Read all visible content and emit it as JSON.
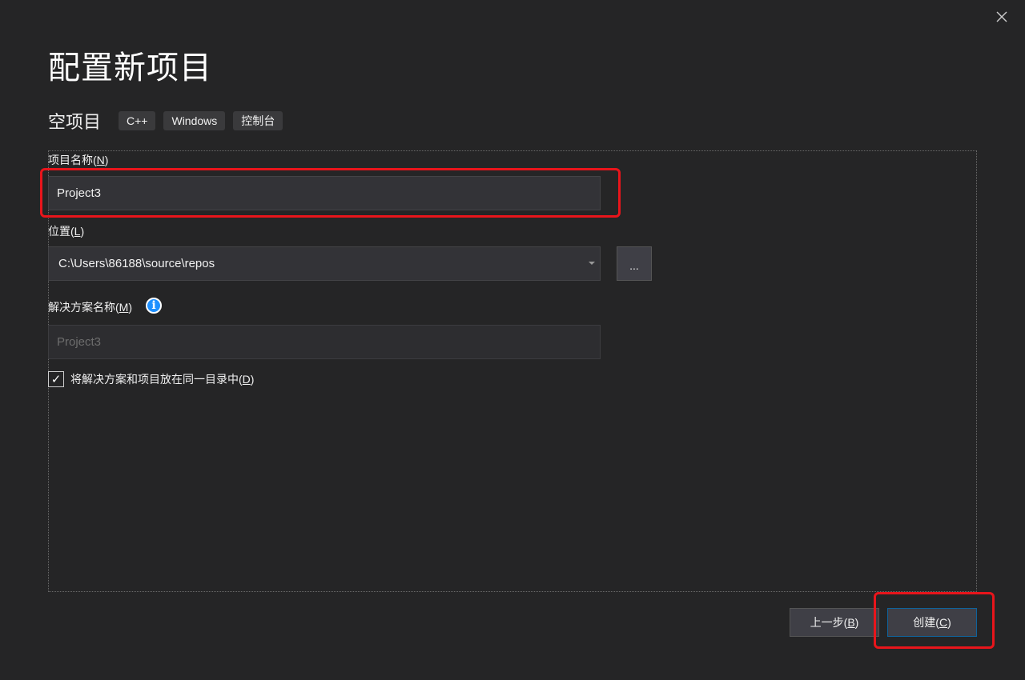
{
  "header": {
    "title": "配置新项目",
    "close_icon": "close-icon"
  },
  "template": {
    "name": "空项目",
    "tags": [
      "C++",
      "Windows",
      "控制台"
    ]
  },
  "form": {
    "project_name": {
      "label": "项目名称",
      "access_key": "N",
      "value": "Project3"
    },
    "location": {
      "label": "位置",
      "access_key": "L",
      "value": "C:\\Users\\86188\\source\\repos",
      "browse_label": "..."
    },
    "solution_name": {
      "label": "解决方案名称",
      "access_key": "M",
      "value": "Project3",
      "info_icon": "info-icon"
    },
    "same_directory": {
      "label": "将解决方案和项目放在同一目录中",
      "access_key": "D",
      "checked": true
    }
  },
  "footer": {
    "back": {
      "label": "上一步",
      "access_key": "B"
    },
    "create": {
      "label": "创建",
      "access_key": "C"
    }
  },
  "colors": {
    "background": "#252526",
    "input_bg": "#333337",
    "button_bg": "#3f3f46",
    "highlight": "#e8151b",
    "info": "#1e90ff"
  }
}
